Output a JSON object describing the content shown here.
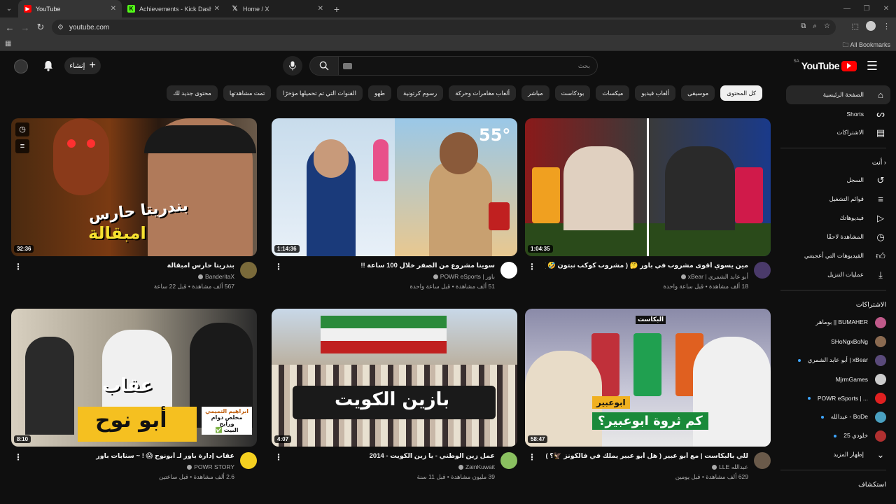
{
  "browser": {
    "tabs": [
      {
        "title": "YouTube",
        "icon": "youtube-favicon",
        "active": true
      },
      {
        "title": "Achievements - Kick Dashboard",
        "icon": "kick-favicon"
      },
      {
        "title": "Home / X",
        "icon": "x-favicon"
      }
    ],
    "url": "youtube.com",
    "all_bookmarks": "All Bookmarks"
  },
  "header": {
    "logo_text": "YouTube",
    "country_code": "SA",
    "search_placeholder": "بحث",
    "create_label": "إنشاء"
  },
  "chips": [
    "كل المحتوى",
    "موسيقى",
    "ألعاب فيديو",
    "ميكسات",
    "بودكاست",
    "مباشر",
    "ألعاب مغامرات وحركة",
    "رسوم كرتونية",
    "طهو",
    "القنوات التي تم تحميلها مؤخرًا",
    "تمت مشاهدتها",
    "محتوى جديد لك"
  ],
  "sidebar": {
    "main": [
      {
        "label": "الصفحة الرئيسية",
        "icon": "home-icon"
      },
      {
        "label": "Shorts",
        "icon": "shorts-icon"
      },
      {
        "label": "الاشتراكات",
        "icon": "subscriptions-icon"
      }
    ],
    "you_header": "أنت",
    "you": [
      {
        "label": "السجل",
        "icon": "history-icon"
      },
      {
        "label": "قوائم التشغيل",
        "icon": "playlists-icon"
      },
      {
        "label": "فيديوهاتك",
        "icon": "your-videos-icon"
      },
      {
        "label": "المشاهدة لاحقًا",
        "icon": "watch-later-icon"
      },
      {
        "label": "الفيديوهات التي أعجبتني",
        "icon": "liked-icon"
      },
      {
        "label": "عمليات التنزيل",
        "icon": "download-icon"
      }
    ],
    "subs_header": "الاشتراكات",
    "subs": [
      {
        "label": "بوماهر || BUMAHER",
        "color": "#c05a8a"
      },
      {
        "label": "SHoNgxBoNg",
        "color": "#8a6a50",
        "dot": false
      },
      {
        "label": "أبو عابد الشمري | xBear",
        "color": "#5a4a7a",
        "dot": true
      },
      {
        "label": "MjrmGames",
        "color": "#cccccc",
        "dot": false
      },
      {
        "label": "POWR eSports | ...",
        "color": "#e02020",
        "dot": true
      },
      {
        "label": "عبدالله - BoDe",
        "color": "#4aa0c0",
        "dot": true
      },
      {
        "label": "خلودي 25",
        "color": "#b03030",
        "dot": true
      }
    ],
    "show_more": "إظهار المزيد",
    "explore_header": "استكشاف"
  },
  "videos": [
    {
      "duration": "32:36",
      "title": "بندريتا حارس امبقالة",
      "channel": "BanderitaX",
      "views": "567 ألف مشاهدة",
      "age": "قبل 22 ساعة",
      "avatar": "#7a6a3a"
    },
    {
      "duration": "1:14:36",
      "title": "سوينا مشروع من الصفر خلال 100 ساعة !!",
      "channel": "باور | POWR eSports",
      "views": "51 ألف مشاهدة",
      "age": "قبل ساعة واحدة",
      "avatar": "#ffffff"
    },
    {
      "duration": "1:04:35",
      "title": "مين يسوي أقوى مشروب في باور 🤔 ( مشروب كوكب نبتون 🤣 )",
      "channel": "أبو عابد الشمري | xBear",
      "views": "18 ألف مشاهدة",
      "age": "قبل ساعة واحدة",
      "avatar": "#4a3a6a"
    },
    {
      "duration": "8:10",
      "title": "عقاب إدارة باور لـ أبونوح 😱 ! ~ سنابات باور",
      "channel": "POWR STORY",
      "views": "2.6 ألف مشاهدة",
      "age": "قبل ساعتين",
      "avatar": "#f5d020"
    },
    {
      "duration": "4:07",
      "title": "عمل زين الوطني - يا زين الكويت - 2014",
      "channel": "ZainKuwait",
      "views": "39 مليون مشاهدة",
      "age": "قبل 11 سنة",
      "avatar": "#8ac060"
    },
    {
      "duration": "58:47",
      "title": "للي بالبكاست | مع أبو عبير ( هل أبو عبير يملك في فالكونز 🦅؟ )",
      "channel": "عبدالله LLE",
      "views": "629 ألف مشاهدة",
      "age": "قبل يومين",
      "avatar": "#6a5a4a"
    }
  ],
  "thumb_text": {
    "v1": [
      "بندريتا حارس",
      "امبقالة"
    ],
    "v2": "55°",
    "v4": [
      "أبو نوح",
      "عقاب",
      "ابراهيم التميمي",
      "مخلص دوام ورايح",
      "البيت ✅"
    ],
    "v5": "بازين الكويت",
    "v6": [
      "ابوعبير",
      "كم ثروة ابوعبير؟",
      "البكاست"
    ]
  }
}
